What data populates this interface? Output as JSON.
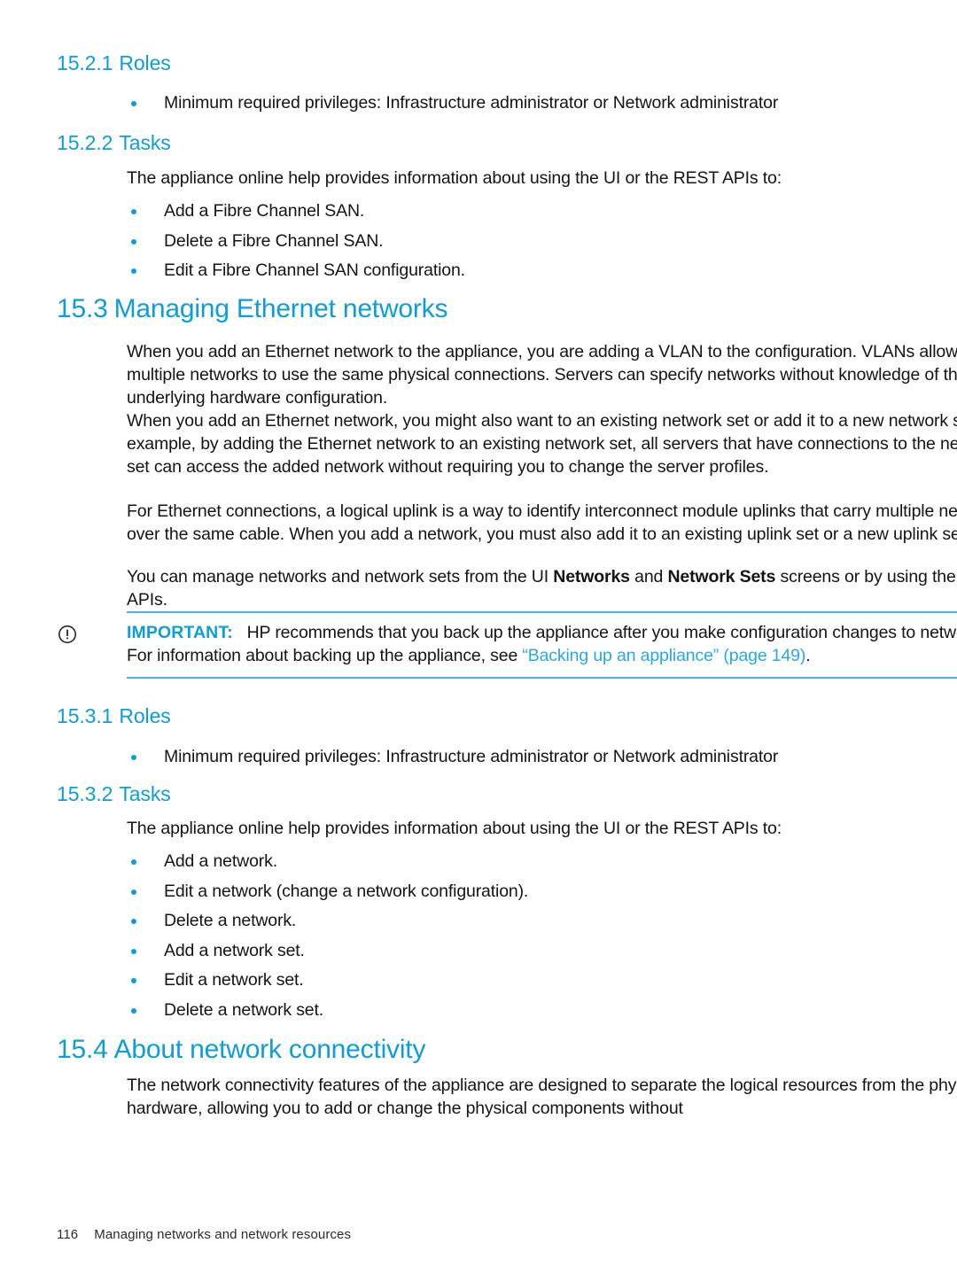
{
  "colors": {
    "heading_blue": "#0d9ddb",
    "rule_blue": "#46b4e3",
    "bullet_blue": "#0d9ddb",
    "link_blue": "#29a8e0",
    "body_text": "#141414"
  },
  "sections": {
    "roles_1521": {
      "number": "15.2.1",
      "title": "Roles",
      "bullets": [
        "Minimum required privileges: Infrastructure administrator or Network administrator"
      ]
    },
    "tasks_1522": {
      "number": "15.2.2",
      "title": "Tasks",
      "intro": "The appliance online help provides information about using the UI or the REST APIs to:",
      "bullets": [
        "Add a Fibre Channel SAN.",
        "Delete a Fibre Channel SAN.",
        "Edit a Fibre Channel SAN configuration."
      ]
    },
    "managing_ethernet_153": {
      "number": "15.3",
      "title": "Managing Ethernet networks",
      "paragraphs": [
        "When you add an Ethernet network to the appliance, you are adding a VLAN to the configuration. VLANs allow multiple networks to use the same physical connections. Servers can specify networks without knowledge of the underlying hardware configuration.",
        "When you add an Ethernet network, you might also want to an existing network set or add it to a new network set. For example, by adding the Ethernet network to an existing network set, all servers that have connections to the network set can access the added network without requiring you to change the server profiles.",
        "For Ethernet connections, a logical uplink is a way to identify interconnect module uplinks that carry multiple networks over the same cable. When you add a network, you must also add it to an existing uplink set or a new uplink set."
      ],
      "para_with_bold": {
        "before": "You can manage networks and network sets from the UI ",
        "bold1": "Networks",
        "middle": " and ",
        "bold2": "Network Sets",
        "after": " screens or by using the REST APIs."
      }
    },
    "important_note": {
      "icon": "important-icon",
      "label": "IMPORTANT:",
      "text_before": "HP recommends that you back up the appliance after you make configuration changes to networks. For information about backing up the appliance, see ",
      "xref": "“Backing up an appliance” (page 149)",
      "text_after": "."
    },
    "roles_1531": {
      "number": "15.3.1",
      "title": "Roles",
      "bullets": [
        "Minimum required privileges: Infrastructure administrator or Network administrator"
      ]
    },
    "tasks_1532": {
      "number": "15.3.2",
      "title": "Tasks",
      "intro": "The appliance online help provides information about using the UI or the REST APIs to:",
      "bullets": [
        "Add a network.",
        "Edit a network (change a network configuration).",
        "Delete a network.",
        "Add a network set.",
        "Edit a network set.",
        "Delete a network set."
      ]
    },
    "about_connectivity_154": {
      "number": "15.4",
      "title": "About network connectivity",
      "paragraphs": [
        "The network connectivity features of the appliance are designed to separate the logical resources from the physical hardware, allowing you to add or change the physical components without"
      ]
    }
  },
  "footer": {
    "page_number": "116",
    "chapter_title": "Managing networks and network resources"
  }
}
